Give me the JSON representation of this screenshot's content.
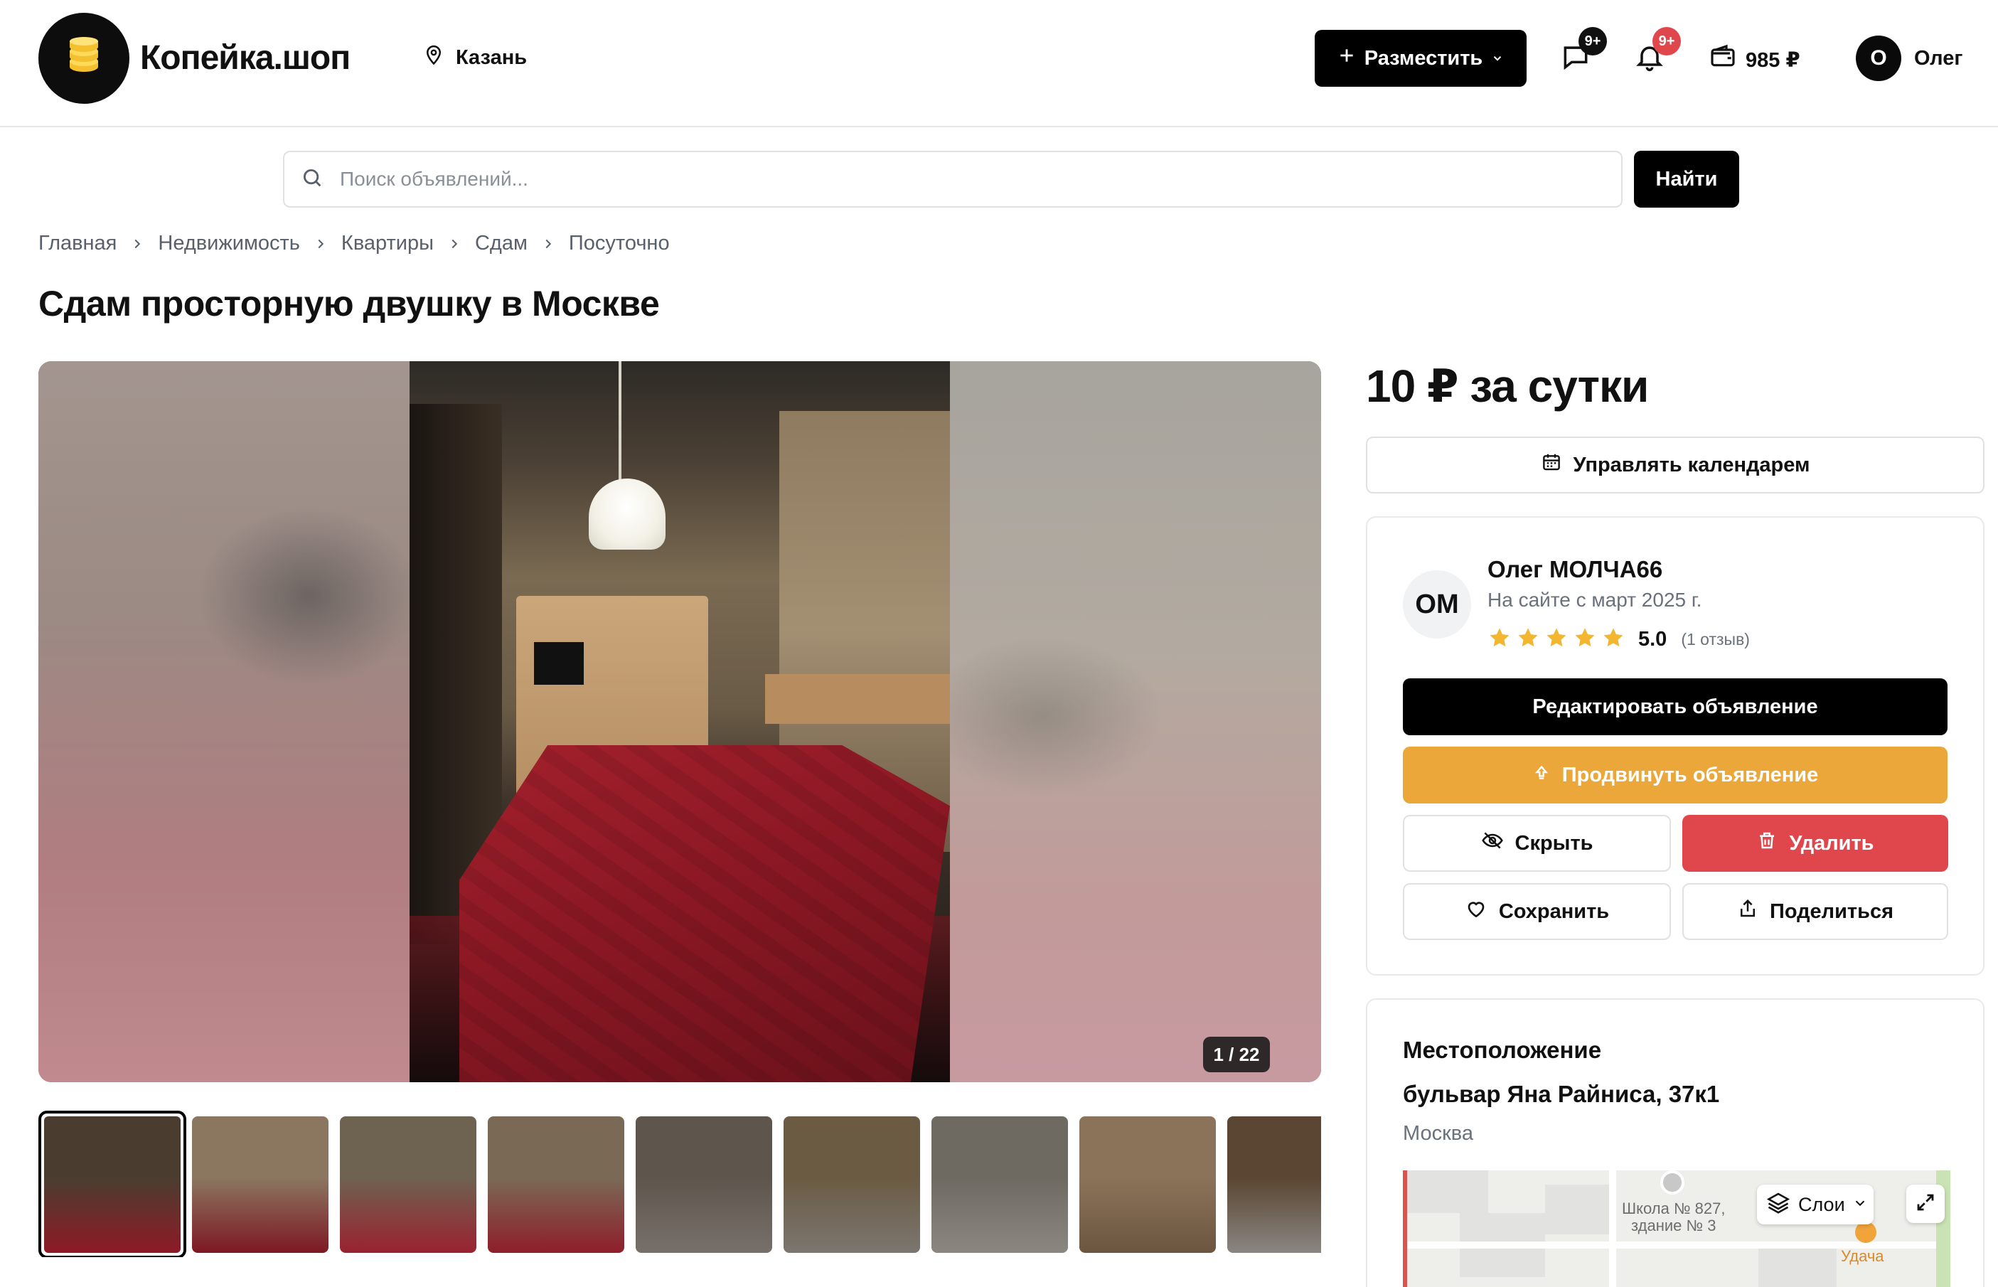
{
  "header": {
    "logo_text": "Копейка.шоп",
    "city": "Казань",
    "post_button_label": "Разместить",
    "messages_badge": "9+",
    "notifications_badge": "9+",
    "wallet_balance": "985 ₽",
    "user_initial": "О",
    "user_name": "Олег"
  },
  "search": {
    "placeholder": "Поиск объявлений...",
    "button_label": "Найти"
  },
  "breadcrumbs": [
    "Главная",
    "Недвижимость",
    "Квартиры",
    "Сдам",
    "Посуточно"
  ],
  "listing": {
    "title": "Сдам просторную двушку в Москве",
    "price": "10 ₽ за сутки",
    "photo_counter": "1 / 22"
  },
  "gallery": {
    "thumbnails": [
      {
        "top": "#4a3d30",
        "bottom": "#8e1a26"
      },
      {
        "top": "#8b7760",
        "bottom": "#7e1824"
      },
      {
        "top": "#6e6250",
        "bottom": "#9a2230"
      },
      {
        "top": "#7a6a55",
        "bottom": "#8e1e2a"
      },
      {
        "top": "#5e564d",
        "bottom": "#77706a"
      },
      {
        "top": "#6b5b43",
        "bottom": "#7b7670"
      },
      {
        "top": "#6e6a62",
        "bottom": "#8c8680"
      },
      {
        "top": "#8a7358",
        "bottom": "#6c5640"
      },
      {
        "top": "#5a4632",
        "bottom": "#8a8682"
      }
    ]
  },
  "calendar_button_label": "Управлять календарем",
  "seller": {
    "initials": "ОМ",
    "name": "Олег МОЛЧА66",
    "member_since": "На сайте с март 2025 г.",
    "rating": "5.0",
    "rating_stars": 5,
    "reviews": "(1 отзыв)"
  },
  "actions": {
    "edit": "Редактировать объявление",
    "promote": "Продвинуть объявление",
    "hide": "Скрыть",
    "delete": "Удалить",
    "save": "Сохранить",
    "share": "Поделиться"
  },
  "location": {
    "title": "Местоположение",
    "address": "бульвар Яна Райниса, 37к1",
    "city": "Москва",
    "map_school_line1": "Школа № 827,",
    "map_school_line2": "здание № 3",
    "map_poi": "Удача",
    "map_layers_label": "Слои"
  },
  "colors": {
    "brand": "#000000",
    "promote": "#eba73a",
    "danger": "#e0474c",
    "star": "#f2b631",
    "badge_messages": "#111111",
    "badge_notifications": "#e0474c"
  }
}
